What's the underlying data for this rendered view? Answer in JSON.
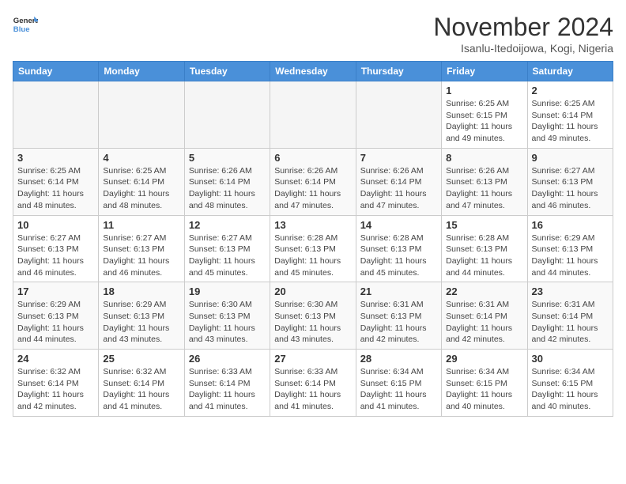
{
  "header": {
    "logo_line1": "General",
    "logo_line2": "Blue",
    "month_title": "November 2024",
    "location": "Isanlu-Itedoijowa, Kogi, Nigeria"
  },
  "weekdays": [
    "Sunday",
    "Monday",
    "Tuesday",
    "Wednesday",
    "Thursday",
    "Friday",
    "Saturday"
  ],
  "weeks": [
    [
      {
        "day": "",
        "info": ""
      },
      {
        "day": "",
        "info": ""
      },
      {
        "day": "",
        "info": ""
      },
      {
        "day": "",
        "info": ""
      },
      {
        "day": "",
        "info": ""
      },
      {
        "day": "1",
        "info": "Sunrise: 6:25 AM\nSunset: 6:15 PM\nDaylight: 11 hours and 49 minutes."
      },
      {
        "day": "2",
        "info": "Sunrise: 6:25 AM\nSunset: 6:14 PM\nDaylight: 11 hours and 49 minutes."
      }
    ],
    [
      {
        "day": "3",
        "info": "Sunrise: 6:25 AM\nSunset: 6:14 PM\nDaylight: 11 hours and 48 minutes."
      },
      {
        "day": "4",
        "info": "Sunrise: 6:25 AM\nSunset: 6:14 PM\nDaylight: 11 hours and 48 minutes."
      },
      {
        "day": "5",
        "info": "Sunrise: 6:26 AM\nSunset: 6:14 PM\nDaylight: 11 hours and 48 minutes."
      },
      {
        "day": "6",
        "info": "Sunrise: 6:26 AM\nSunset: 6:14 PM\nDaylight: 11 hours and 47 minutes."
      },
      {
        "day": "7",
        "info": "Sunrise: 6:26 AM\nSunset: 6:14 PM\nDaylight: 11 hours and 47 minutes."
      },
      {
        "day": "8",
        "info": "Sunrise: 6:26 AM\nSunset: 6:13 PM\nDaylight: 11 hours and 47 minutes."
      },
      {
        "day": "9",
        "info": "Sunrise: 6:27 AM\nSunset: 6:13 PM\nDaylight: 11 hours and 46 minutes."
      }
    ],
    [
      {
        "day": "10",
        "info": "Sunrise: 6:27 AM\nSunset: 6:13 PM\nDaylight: 11 hours and 46 minutes."
      },
      {
        "day": "11",
        "info": "Sunrise: 6:27 AM\nSunset: 6:13 PM\nDaylight: 11 hours and 46 minutes."
      },
      {
        "day": "12",
        "info": "Sunrise: 6:27 AM\nSunset: 6:13 PM\nDaylight: 11 hours and 45 minutes."
      },
      {
        "day": "13",
        "info": "Sunrise: 6:28 AM\nSunset: 6:13 PM\nDaylight: 11 hours and 45 minutes."
      },
      {
        "day": "14",
        "info": "Sunrise: 6:28 AM\nSunset: 6:13 PM\nDaylight: 11 hours and 45 minutes."
      },
      {
        "day": "15",
        "info": "Sunrise: 6:28 AM\nSunset: 6:13 PM\nDaylight: 11 hours and 44 minutes."
      },
      {
        "day": "16",
        "info": "Sunrise: 6:29 AM\nSunset: 6:13 PM\nDaylight: 11 hours and 44 minutes."
      }
    ],
    [
      {
        "day": "17",
        "info": "Sunrise: 6:29 AM\nSunset: 6:13 PM\nDaylight: 11 hours and 44 minutes."
      },
      {
        "day": "18",
        "info": "Sunrise: 6:29 AM\nSunset: 6:13 PM\nDaylight: 11 hours and 43 minutes."
      },
      {
        "day": "19",
        "info": "Sunrise: 6:30 AM\nSunset: 6:13 PM\nDaylight: 11 hours and 43 minutes."
      },
      {
        "day": "20",
        "info": "Sunrise: 6:30 AM\nSunset: 6:13 PM\nDaylight: 11 hours and 43 minutes."
      },
      {
        "day": "21",
        "info": "Sunrise: 6:31 AM\nSunset: 6:13 PM\nDaylight: 11 hours and 42 minutes."
      },
      {
        "day": "22",
        "info": "Sunrise: 6:31 AM\nSunset: 6:14 PM\nDaylight: 11 hours and 42 minutes."
      },
      {
        "day": "23",
        "info": "Sunrise: 6:31 AM\nSunset: 6:14 PM\nDaylight: 11 hours and 42 minutes."
      }
    ],
    [
      {
        "day": "24",
        "info": "Sunrise: 6:32 AM\nSunset: 6:14 PM\nDaylight: 11 hours and 42 minutes."
      },
      {
        "day": "25",
        "info": "Sunrise: 6:32 AM\nSunset: 6:14 PM\nDaylight: 11 hours and 41 minutes."
      },
      {
        "day": "26",
        "info": "Sunrise: 6:33 AM\nSunset: 6:14 PM\nDaylight: 11 hours and 41 minutes."
      },
      {
        "day": "27",
        "info": "Sunrise: 6:33 AM\nSunset: 6:14 PM\nDaylight: 11 hours and 41 minutes."
      },
      {
        "day": "28",
        "info": "Sunrise: 6:34 AM\nSunset: 6:15 PM\nDaylight: 11 hours and 41 minutes."
      },
      {
        "day": "29",
        "info": "Sunrise: 6:34 AM\nSunset: 6:15 PM\nDaylight: 11 hours and 40 minutes."
      },
      {
        "day": "30",
        "info": "Sunrise: 6:34 AM\nSunset: 6:15 PM\nDaylight: 11 hours and 40 minutes."
      }
    ]
  ]
}
